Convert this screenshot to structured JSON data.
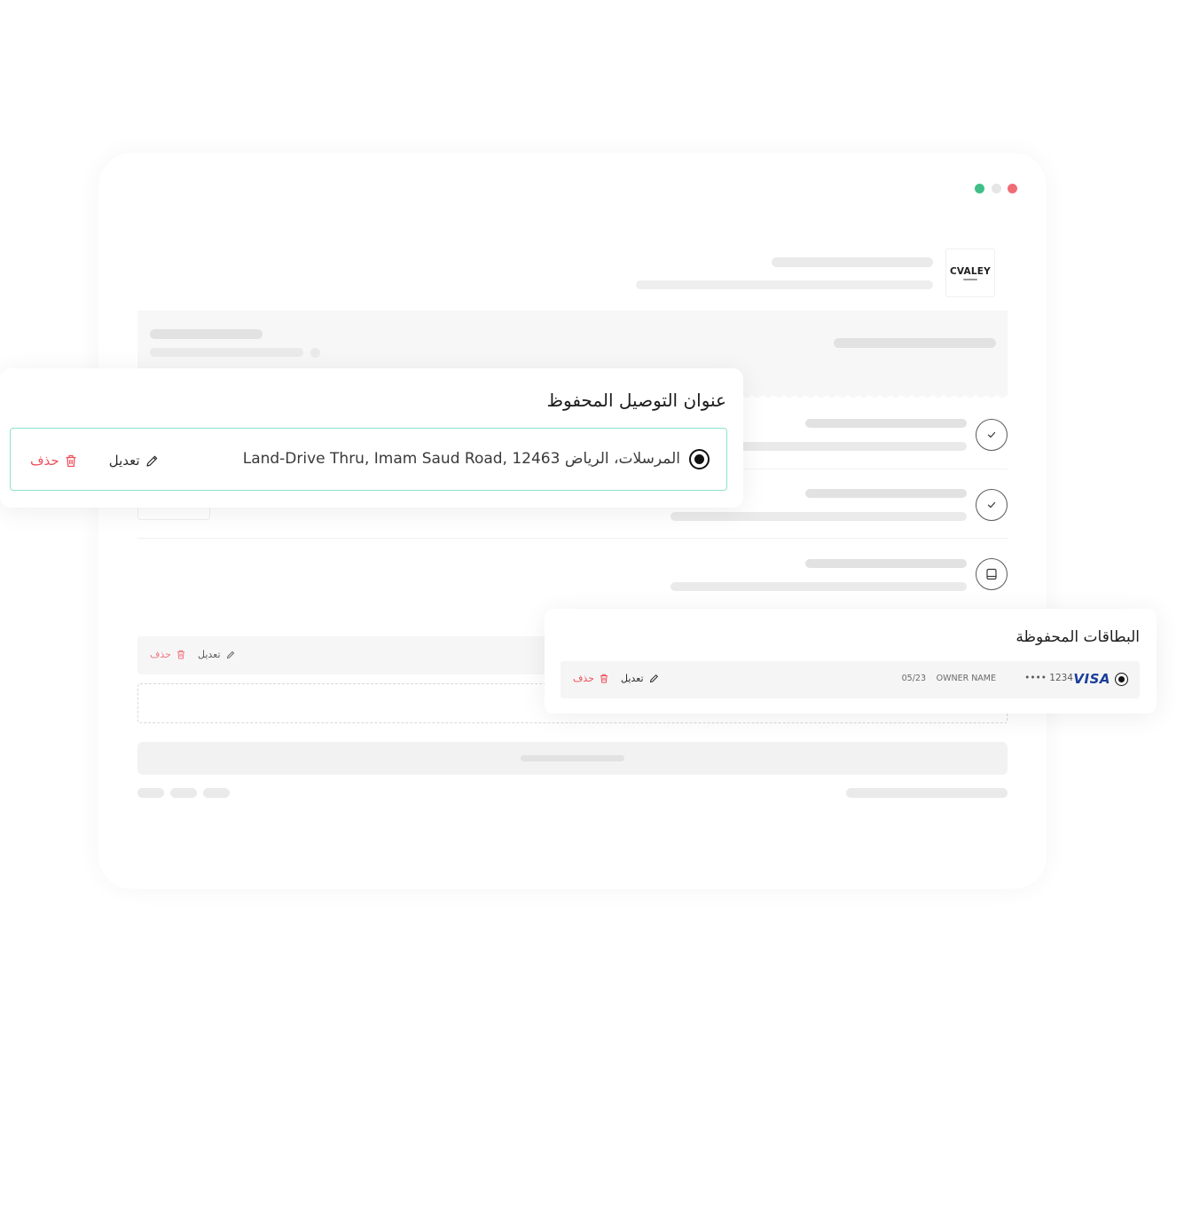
{
  "window": {
    "traffic_lights": {
      "green": "#3fbf86",
      "gray": "#e6e6e6",
      "red": "#f06c75"
    },
    "logo": {
      "text": "CVALEY"
    }
  },
  "checkout_steps": {
    "icons": [
      "check-icon",
      "check-icon",
      "tablet-icon"
    ]
  },
  "background_row": {
    "edit_label": "تعديل",
    "delete_label": "حذف"
  },
  "saved_address": {
    "title": "عنوان التوصيل المحفوظ",
    "address": "المرسلات، الرياض Land-Drive Thru, Imam Saud Road, 12463",
    "selected": true,
    "edit_label": "تعديل",
    "delete_label": "حذف",
    "border_color": "#8ee0cf",
    "delete_color": "#ee4f5b"
  },
  "saved_cards": {
    "title": "البطاقات المحفوظة",
    "card": {
      "brand": "VISA",
      "number": "•••• 1234",
      "owner": "OWNER NAME",
      "expiry": "05/23",
      "selected": true
    },
    "edit_label": "تعديل",
    "delete_label": "حذف"
  }
}
